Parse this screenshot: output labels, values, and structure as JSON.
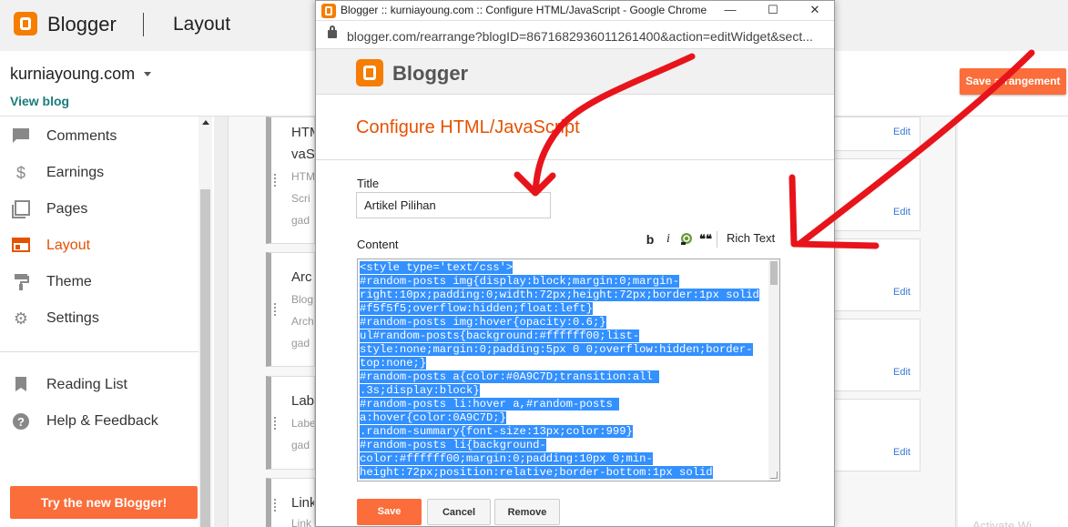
{
  "header": {
    "brand": "Blogger",
    "section": "Layout"
  },
  "blog": {
    "name": "kurniayoung.com",
    "view_blog": "View blog"
  },
  "save_arrangement": "Save arrangement",
  "sidebar": {
    "items": [
      {
        "label": "Comments",
        "icon": "comment-icon"
      },
      {
        "label": "Earnings",
        "icon": "dollar-icon"
      },
      {
        "label": "Pages",
        "icon": "pages-icon"
      },
      {
        "label": "Layout",
        "icon": "layout-icon",
        "active": true
      },
      {
        "label": "Theme",
        "icon": "paint-roller-icon"
      },
      {
        "label": "Settings",
        "icon": "gear-icon"
      },
      {
        "label": "Reading List",
        "icon": "bookmark-icon"
      },
      {
        "label": "Help & Feedback",
        "icon": "help-icon"
      }
    ],
    "try_new": "Try the new Blogger!"
  },
  "widgets": [
    {
      "title": "HTM",
      "title2": "vaS",
      "lines": [
        "HTM",
        "Scri",
        "gad"
      ]
    },
    {
      "title": "Arc",
      "lines": [
        "Blog",
        "Arch",
        "gad"
      ]
    },
    {
      "title": "Lab",
      "lines": [
        "Labe",
        "gad"
      ]
    },
    {
      "title": "Link",
      "lines": [
        "Link"
      ]
    }
  ],
  "edit_label": "Edit",
  "watermark": "Activate Wi",
  "popup": {
    "window_title": "Blogger :: kurniayoung.com :: Configure HTML/JavaScript - Google Chrome",
    "url": "blogger.com/rearrange?blogID=8671682936011261400&action=editWidget&sect...",
    "brand": "Blogger",
    "heading": "Configure HTML/JavaScript",
    "title_label": "Title",
    "title_value": "Artikel Pilihan",
    "content_label": "Content",
    "toolbar": {
      "bold": "b",
      "italic": "i",
      "quote": "❝❝",
      "rich_text": "Rich Text"
    },
    "code_lines": [
      "<style type='text/css'>",
      "#random-posts img{display:block;margin:0;margin-",
      "right:10px;padding:0;width:72px;height:72px;border:1px solid",
      "#f5f5f5;overflow:hidden;float:left}",
      "#random-posts img:hover{opacity:0.6;}",
      "ul#random-posts{background:#ffffff00;list-",
      "style:none;margin:0;padding:5px 0 0;overflow:hidden;border-",
      "top:none;}",
      "#random-posts a{color:#0A9C7D;transition:all ",
      ".3s;display:block}",
      "#random-posts li:hover a,#random-posts ",
      "a:hover{color:0A9C7D;}",
      ".random-summary{font-size:13px;color:999}",
      "#random-posts li{background-",
      "color:#ffffff00;margin:0;padding:10px 0;min-",
      "height:72px;position:relative;border-bottom:1px solid"
    ],
    "buttons": {
      "save": "Save",
      "cancel": "Cancel",
      "remove": "Remove"
    }
  },
  "colors": {
    "accent": "#fb6d3a",
    "brand": "#f57d00",
    "link": "#1b7c7a",
    "selection": "#3390ff",
    "annotation": "#e8141b"
  }
}
